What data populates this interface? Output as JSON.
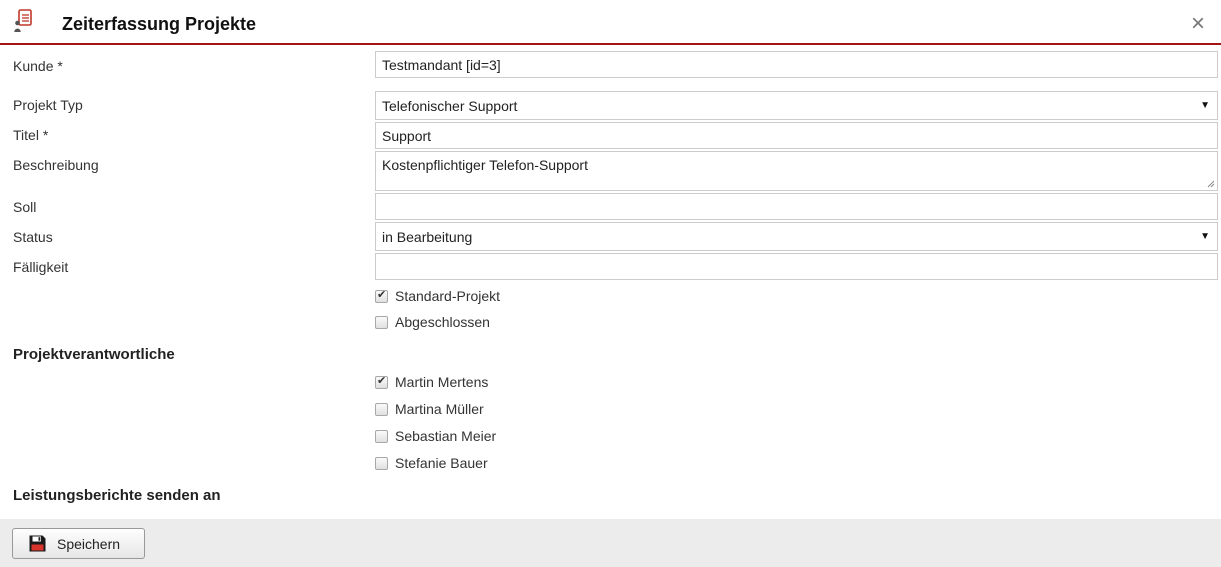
{
  "header": {
    "title": "Zeiterfassung Projekte",
    "close_symbol": "×"
  },
  "form": {
    "kunde": {
      "label": "Kunde *",
      "value": "Testmandant [id=3]"
    },
    "projekt_typ": {
      "label": "Projekt Typ",
      "value": "Telefonischer Support"
    },
    "titel": {
      "label": "Titel *",
      "value": "Support"
    },
    "beschreibung": {
      "label": "Beschreibung",
      "value": "Kostenpflichtiger Telefon-Support"
    },
    "soll": {
      "label": "Soll",
      "value": ""
    },
    "status": {
      "label": "Status",
      "value": "in Bearbeitung"
    },
    "faelligkeit": {
      "label": "Fälligkeit",
      "value": ""
    },
    "options": [
      {
        "label": "Standard-Projekt",
        "checked": true
      },
      {
        "label": "Abgeschlossen",
        "checked": false
      }
    ]
  },
  "responsibles": {
    "heading": "Projektverantwortliche",
    "people": [
      {
        "label": "Martin Mertens",
        "checked": true
      },
      {
        "label": "Martina Müller",
        "checked": false
      },
      {
        "label": "Sebastian Meier",
        "checked": false
      },
      {
        "label": "Stefanie Bauer",
        "checked": false
      }
    ]
  },
  "reports": {
    "heading": "Leistungsberichte senden an"
  },
  "footer": {
    "save_label": "Speichern"
  },
  "icons": {
    "app": "contact-card-icon",
    "save": "floppy-disk-icon",
    "close": "close-icon",
    "dropdown": "triangle-down-icon"
  },
  "colors": {
    "accent": "#a31515"
  }
}
